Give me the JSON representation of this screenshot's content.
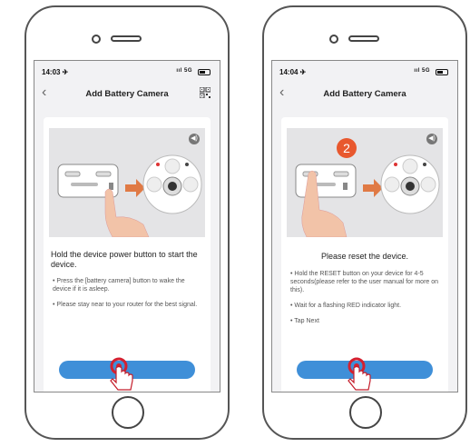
{
  "left_phone": {
    "status_time": "14:03 ✈",
    "status_signal": "ııl 5G",
    "nav_title": "Add Battery Camera",
    "heading": "Hold the device power button to start the device.",
    "bullets": [
      "• Press the [battery camera] button to wake the device if it is asleep.",
      "• Please stay near to your router for the best signal."
    ]
  },
  "right_phone": {
    "status_time": "14:04 ✈",
    "status_signal": "ııl 5G",
    "nav_title": "Add Battery Camera",
    "step_number": "2",
    "heading": "Please reset the device.",
    "bullets": [
      "• Hold the RESET button on your device for 4-5 seconds(please refer to the user manual for more on this).",
      "• Wait for a flashing RED indicator light.",
      "• Tap Next"
    ]
  },
  "icons": {
    "back": "chevron-left-icon",
    "qr": "qr-code-icon",
    "sound": "speaker-icon",
    "tap": "tap-hand-icon"
  },
  "colors": {
    "primary_button": "#3f8fd8",
    "step_badge": "#e8582e",
    "arrow": "#e07a45",
    "tap_ring": "#d42030"
  }
}
